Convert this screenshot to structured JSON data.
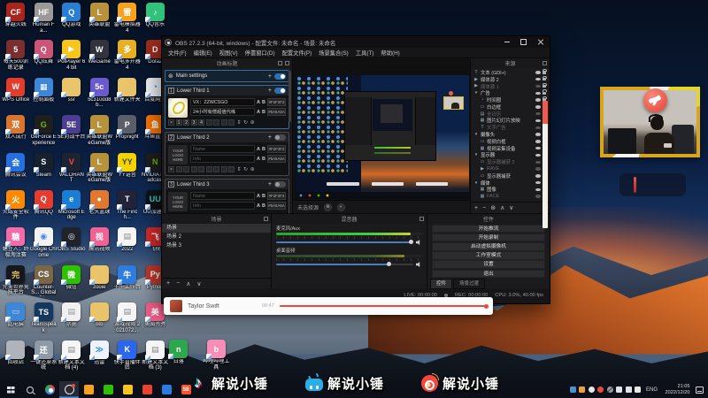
{
  "desktop": {
    "icons": [
      {
        "label": "穿越火线",
        "color": "#a8241c",
        "glyph": "CF"
      },
      {
        "label": "Human Fa...",
        "color": "#9a9a9a",
        "glyph": "HF"
      },
      {
        "label": "QQ游戏",
        "color": "#2a7fd4",
        "glyph": "Q"
      },
      {
        "label": "英雄联盟",
        "color": "#b8923a",
        "glyph": "L"
      },
      {
        "label": "雷电模拟器4",
        "color": "#f6a21c",
        "glyph": "雷"
      },
      {
        "label": "QQ音乐",
        "color": "#31c27c",
        "glyph": "♪"
      },
      {
        "label": "每天500训练记录",
        "color": "#7a2e2e",
        "glyph": "5"
      },
      {
        "label": "QQ炫舞",
        "color": "#cc5577",
        "glyph": "Q"
      },
      {
        "label": "PotPlayer 64 bit",
        "color": "#f8c51c",
        "glyph": "▶"
      },
      {
        "label": "WeGame",
        "color": "#33333d",
        "glyph": "W"
      },
      {
        "label": "雷电多开器4",
        "color": "#e8b021",
        "glyph": "多"
      },
      {
        "label": "Dota2",
        "color": "#9e2b1e",
        "glyph": "D"
      },
      {
        "label": "WPS Office",
        "color": "#e23c2c",
        "glyph": "W"
      },
      {
        "label": "控制面板",
        "color": "#3f87d6",
        "glyph": "▦"
      },
      {
        "label": "ssr",
        "color": "#e9c46a",
        "glyph": ""
      },
      {
        "label": "5c310dd8b...",
        "color": "#6a5acd",
        "glyph": "5c"
      },
      {
        "label": "新建文件夹",
        "color": "#e9c46a",
        "glyph": ""
      },
      {
        "label": "百度网盘",
        "color": "#f0f5fa",
        "glyph": "◔",
        "fg": "#2a6fd4"
      },
      {
        "label": "双人成行",
        "color": "#d87630",
        "glyph": "双"
      },
      {
        "label": "GeForce Experience",
        "color": "#1f1f1f",
        "glyph": "G",
        "fg": "#76b900"
      },
      {
        "label": "5E对战平台",
        "color": "#4b3d8f",
        "glyph": "5E"
      },
      {
        "label": "英雄联盟WeGame版",
        "color": "#b8923a",
        "glyph": "L"
      },
      {
        "label": "Propnight",
        "color": "#5a5f6a",
        "glyph": "P"
      },
      {
        "label": "斗鱼直播",
        "color": "#ff7500",
        "glyph": "鱼"
      },
      {
        "label": "腾讯会议",
        "color": "#2470e0",
        "glyph": "会"
      },
      {
        "label": "Steam",
        "color": "#17202d",
        "glyph": "S"
      },
      {
        "label": "VALORANT",
        "color": "#1b2430",
        "glyph": "V",
        "fg": "#fa4454"
      },
      {
        "label": "英雄联盟WeGame版",
        "color": "#b8923a",
        "glyph": "L"
      },
      {
        "label": "YY语音",
        "color": "#f5d400",
        "glyph": "YY",
        "fg": "#444"
      },
      {
        "label": "NVIDIA Broadcast",
        "color": "#1f1f1f",
        "glyph": "N",
        "fg": "#76b900"
      },
      {
        "label": "火绒安全软件",
        "color": "#ff8a00",
        "glyph": "火"
      },
      {
        "label": "腾讯QQ",
        "color": "#e43c2f",
        "glyph": "Q"
      },
      {
        "label": "Microsoft Edge",
        "color": "#1a7fd4",
        "glyph": "e"
      },
      {
        "label": "老头篮球",
        "color": "#e07830",
        "glyph": "●"
      },
      {
        "label": "The Finch...",
        "color": "#23233a",
        "glyph": "T"
      },
      {
        "label": "UU加速器",
        "color": "#101418",
        "glyph": "UU",
        "fg": "#3adbc3"
      },
      {
        "label": "糖豆人：终极淘汰赛",
        "color": "#f46ba9",
        "glyph": "糖"
      },
      {
        "label": "Google Chrome",
        "color": "#f2f2f2",
        "glyph": "◉",
        "fg": "#4285f4"
      },
      {
        "label": "OBS Studio",
        "color": "#20242a",
        "glyph": "◎"
      },
      {
        "label": "腾讯视频",
        "color": "#f06292",
        "glyph": "视"
      },
      {
        "label": "2022",
        "color": "#f5f5f5",
        "glyph": "▤",
        "fg": "#888"
      },
      {
        "label": "飞秋",
        "color": "#d42a2a",
        "glyph": "飞"
      },
      {
        "label": "完美世界竞技平台",
        "color": "#17181d",
        "glyph": "完",
        "fg": "#e8c268"
      },
      {
        "label": "Counter-S... Global Of...",
        "color": "#7a6748",
        "glyph": "CS"
      },
      {
        "label": "微信",
        "color": "#2dc100",
        "glyph": "微"
      },
      {
        "label": "zooie",
        "color": "#e9c46a",
        "glyph": ""
      },
      {
        "label": "千牛工作台",
        "color": "#2f7de0",
        "glyph": "牛"
      },
      {
        "label": "Python",
        "color": "#c0392b",
        "glyph": "Py"
      },
      {
        "label": "此电脑",
        "color": "#3f87d6",
        "glyph": "▭",
        "fg": "#cde3f5"
      },
      {
        "label": "TeamSpeak",
        "color": "#14375e",
        "glyph": "TS"
      },
      {
        "label": "票据",
        "color": "#f0f0f0",
        "glyph": "▤",
        "fg": "#999"
      },
      {
        "label": "btb",
        "color": "#e9c46a",
        "glyph": ""
      },
      {
        "label": "游戏视频 2021072...",
        "color": "#f5f5f5",
        "glyph": "▤",
        "fg": "#888"
      },
      {
        "label": "美图秀秀",
        "color": "#f25f8a",
        "glyph": "美"
      },
      {
        "label": "回收站",
        "color": "#aeb4ba",
        "glyph": ""
      },
      {
        "label": "一键还原系统",
        "color": "#8e9aa8",
        "glyph": "还"
      },
      {
        "label": "新建文本文档 (4)",
        "color": "#f5f5f5",
        "glyph": "▤",
        "fg": "#888"
      },
      {
        "label": "迅雷",
        "color": "#eef4ff",
        "glyph": "≫",
        "fg": "#2a7de0"
      },
      {
        "label": "快手直播伴侣",
        "color": "#2a66f0",
        "glyph": "K"
      },
      {
        "label": "新建文本文档 (3)",
        "color": "#f5f5f5",
        "glyph": "▤",
        "fg": "#888"
      }
    ],
    "extra_icons": [
      {
        "label": "日落",
        "color": "#2ea84f",
        "glyph": "n"
      },
      {
        "label": "哔哩哔哩工具",
        "color": "#f98fb6",
        "glyph": "b"
      }
    ]
  },
  "obs": {
    "window_title": "OBS 27.2.3 (64-bit, windows) - 配置文件: 未命名 - 场景: 未命名",
    "menu_items": [
      "文件(F)",
      "编辑(E)",
      "视图(V)",
      "停靠窗口(D)",
      "配置文件(P)",
      "场景集合(S)",
      "工具(T)",
      "帮助(H)"
    ],
    "glyphs": {
      "add": "+",
      "remove": "−",
      "gear": "⊛",
      "up": "∧",
      "down": "∨",
      "close_slot": "×",
      "refresh": "↻",
      "updown": "⇕",
      "filter": "◐",
      "text_a": "A",
      "text_b": "B"
    },
    "animated_titles": {
      "dock_title": "动画标题",
      "main_settings_label": "Main settings",
      "items": [
        {
          "num": "1",
          "title": "Lower Third 1",
          "cls": "",
          "tog": "on",
          "logo_cls": "racket",
          "logo_text": "",
          "name_value": "VX：ZZWCSGO",
          "name_color": "#F2F2F2",
          "info_value": "24小时有偿超值代练",
          "info_color": "#5A5A5A",
          "s1": "1",
          "s2": "2",
          "s3": "3",
          "s4": "4"
        },
        {
          "num": "2",
          "title": "Lower Third 2",
          "cls": "off ph",
          "tog": "off",
          "logo_cls": "phtext",
          "logo_text": "YOUR LOGO HERE",
          "name_value": "Name",
          "name_color": "#F2F2F2",
          "info_value": "Info",
          "info_color": "#5A5A5A",
          "s1": "",
          "s2": "",
          "s3": "",
          "s4": ""
        },
        {
          "num": "3",
          "title": "Lower Third 3",
          "cls": "off ph",
          "tog": "off",
          "logo_cls": "phtext",
          "logo_text": "YOUR LOGO HERE",
          "name_value": "Name",
          "name_color": "#F2F2F2",
          "info_value": "Info",
          "info_color": "#5A5A5A",
          "s1": "",
          "s2": "",
          "s3": "",
          "s4": ""
        }
      ]
    },
    "preview": {
      "no_source_label": "未选择源"
    },
    "sources": {
      "dock_title": "来源",
      "items": [
        {
          "ico": "T",
          "label": "文本 (GDI+)",
          "cls": ""
        },
        {
          "ico": "▶",
          "label": "媒体源 2",
          "cls": ""
        },
        {
          "ico": "▶",
          "label": "媒体源 1",
          "cls": "dim"
        },
        {
          "ico": "▾",
          "label": "广告",
          "cls": "grp"
        },
        {
          "ico": "◔",
          "label": "时间圈",
          "cls": "ind"
        },
        {
          "ico": "▭",
          "label": "白边框",
          "cls": "ind"
        },
        {
          "ico": "▤",
          "label": "全日历",
          "cls": "ind dim"
        },
        {
          "ico": "▦",
          "label": "图片幻灯片放映",
          "cls": "ind"
        },
        {
          "ico": "T",
          "label": "文字广告",
          "cls": "ind dim"
        },
        {
          "ico": "▾",
          "label": "摄像头",
          "cls": "grp"
        },
        {
          "ico": "▭",
          "label": "视频白框",
          "cls": "ind"
        },
        {
          "ico": "▦",
          "label": "视频采集设备",
          "cls": "ind"
        },
        {
          "ico": "▾",
          "label": "显示器",
          "cls": "grp"
        },
        {
          "ico": "▭",
          "label": "显示器捕获 2",
          "cls": "ind dim"
        },
        {
          "ico": "▶",
          "label": "RAVE",
          "cls": "ind dim"
        },
        {
          "ico": "▭",
          "label": "显示器捕获",
          "cls": "ind"
        },
        {
          "ico": "▾",
          "label": "媒体",
          "cls": "grp"
        },
        {
          "ico": "▦",
          "label": "图像",
          "cls": "ind"
        },
        {
          "ico": "▦",
          "label": "FACE",
          "cls": "ind dim"
        }
      ]
    },
    "scenes": {
      "dock_title": "场景",
      "items": [
        {
          "label": "场景",
          "cls": "sel"
        },
        {
          "label": "场景 2",
          "cls": ""
        },
        {
          "label": "场景 3",
          "cls": ""
        }
      ]
    },
    "mixer": {
      "dock_title": "混音器",
      "channels": [
        {
          "name": "麦克风/Aux",
          "fill": "92%",
          "fill_cls": "bright",
          "vol": "98%",
          "knob": "98%"
        },
        {
          "name": "桌面音频",
          "fill": "88%",
          "fill_cls": "dim",
          "vol": "82%",
          "knob": "82%"
        }
      ]
    },
    "controls": {
      "dock_title": "控件",
      "buttons": [
        {
          "label": "开始推流"
        },
        {
          "label": "开始录制"
        },
        {
          "label": "启动虚拟摄像机"
        },
        {
          "label": "工作室模式"
        },
        {
          "label": "设置"
        },
        {
          "label": "退出"
        }
      ],
      "tabs": [
        {
          "label": "控件",
          "cls": "active"
        },
        {
          "label": "场景过渡",
          "cls": ""
        }
      ]
    },
    "status": {
      "live": "LIVE: 00:00:00",
      "rec": "REC: 00:00:00",
      "cpu": "CPU: 3.0%, 40.00 fps"
    }
  },
  "music_player": {
    "title": "Taylor Swift",
    "elapsed": "00:47"
  },
  "stream_overlay": {
    "entries": [
      {
        "platform": "douyin",
        "glyph": "♪",
        "handle": "解说小锤"
      },
      {
        "platform": "bilibili",
        "glyph": "",
        "handle": "解说小锤"
      },
      {
        "platform": "weibo",
        "glyph": "",
        "handle": "解说小锤"
      }
    ]
  },
  "taskbar": {
    "apps": [
      {
        "name": "start",
        "color": "",
        "glyph": ""
      },
      {
        "name": "search",
        "color": "",
        "glyph": ""
      },
      {
        "name": "chrome",
        "color": "",
        "glyph": ""
      },
      {
        "name": "obs",
        "color": "",
        "glyph": "",
        "cls": "active"
      },
      {
        "name": "leidian",
        "color": "#f6a21c",
        "glyph": ""
      },
      {
        "name": "wechat",
        "color": "#2dc100",
        "glyph": ""
      },
      {
        "name": "files",
        "color": "#f8c51c",
        "glyph": ""
      },
      {
        "name": "douyu",
        "color": "#e8432e",
        "glyph": ""
      },
      {
        "name": "tim",
        "color": "#2a7de0",
        "glyph": ""
      },
      {
        "name": "wuba",
        "color": "#ff552e",
        "glyph": "58"
      }
    ],
    "tray_icons": [
      {
        "name": "antivirus",
        "color": "#4a90d2"
      },
      {
        "name": "folder",
        "color": "#e8a33a"
      },
      {
        "name": "microphone",
        "color": "#e8e8e8"
      },
      {
        "name": "recording",
        "color": "#e84a3f"
      },
      {
        "name": "blocked",
        "color": "#9a9aa2"
      },
      {
        "name": "volume",
        "color": "#dfe3ea"
      },
      {
        "name": "display",
        "color": "#dfe3ea"
      },
      {
        "name": "ime",
        "color": "#e8e8e8"
      }
    ],
    "lang": "ENG",
    "time": "21:05",
    "date": "2022/12/20"
  }
}
